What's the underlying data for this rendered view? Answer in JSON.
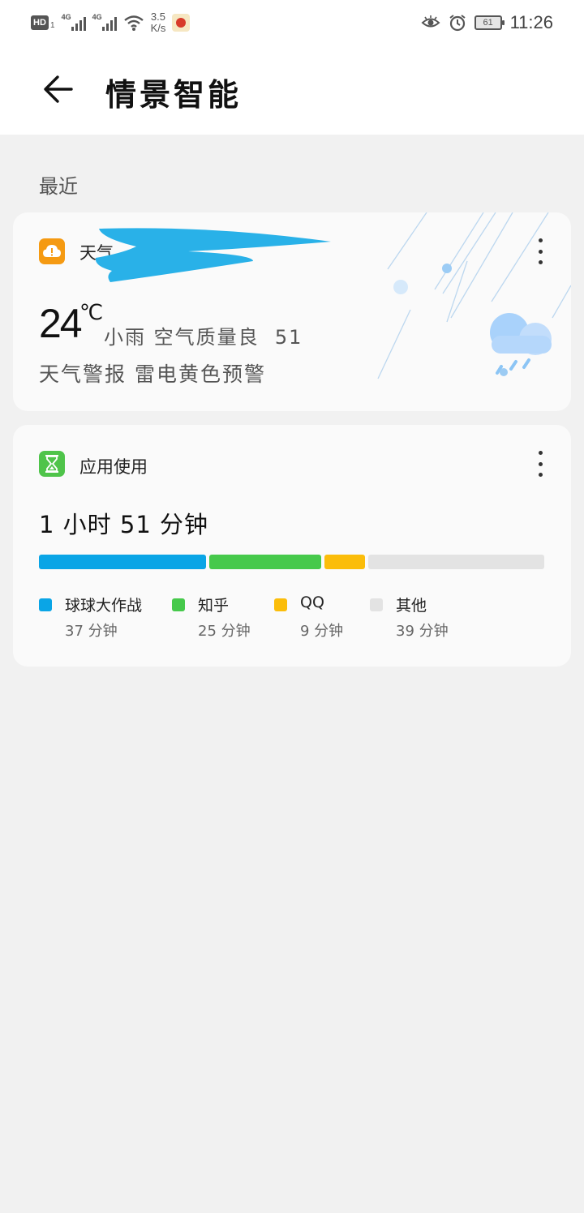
{
  "status_bar": {
    "hd_badge": "HD",
    "sim_number": "1",
    "network_1": "4G",
    "network_2": "4G",
    "speed_value": "3.5",
    "speed_unit": "K/s",
    "battery_level": "61",
    "time": "11:26"
  },
  "header": {
    "title": "情景智能"
  },
  "section": {
    "recent_label": "最近"
  },
  "weather_card": {
    "title": "天气",
    "temperature": "24",
    "temperature_unit": "℃",
    "condition": "小雨 空气质量良  51",
    "alert": "天气警报 雷电黄色预警",
    "icon_color": "#f59a12"
  },
  "usage_card": {
    "title": "应用使用",
    "total": "1 小时 51 分钟",
    "icon_color": "#4fc44a",
    "apps": [
      {
        "name": "球球大作战",
        "duration": "37 分钟",
        "minutes": 37,
        "color": "#0aa5e6"
      },
      {
        "name": "知乎",
        "duration": "25 分钟",
        "minutes": 25,
        "color": "#46c94b"
      },
      {
        "name": "QQ",
        "duration": "9 分钟",
        "minutes": 9,
        "color": "#fbbd0a"
      },
      {
        "name": "其他",
        "duration": "39 分钟",
        "minutes": 39,
        "color": "#e3e3e3"
      }
    ]
  }
}
